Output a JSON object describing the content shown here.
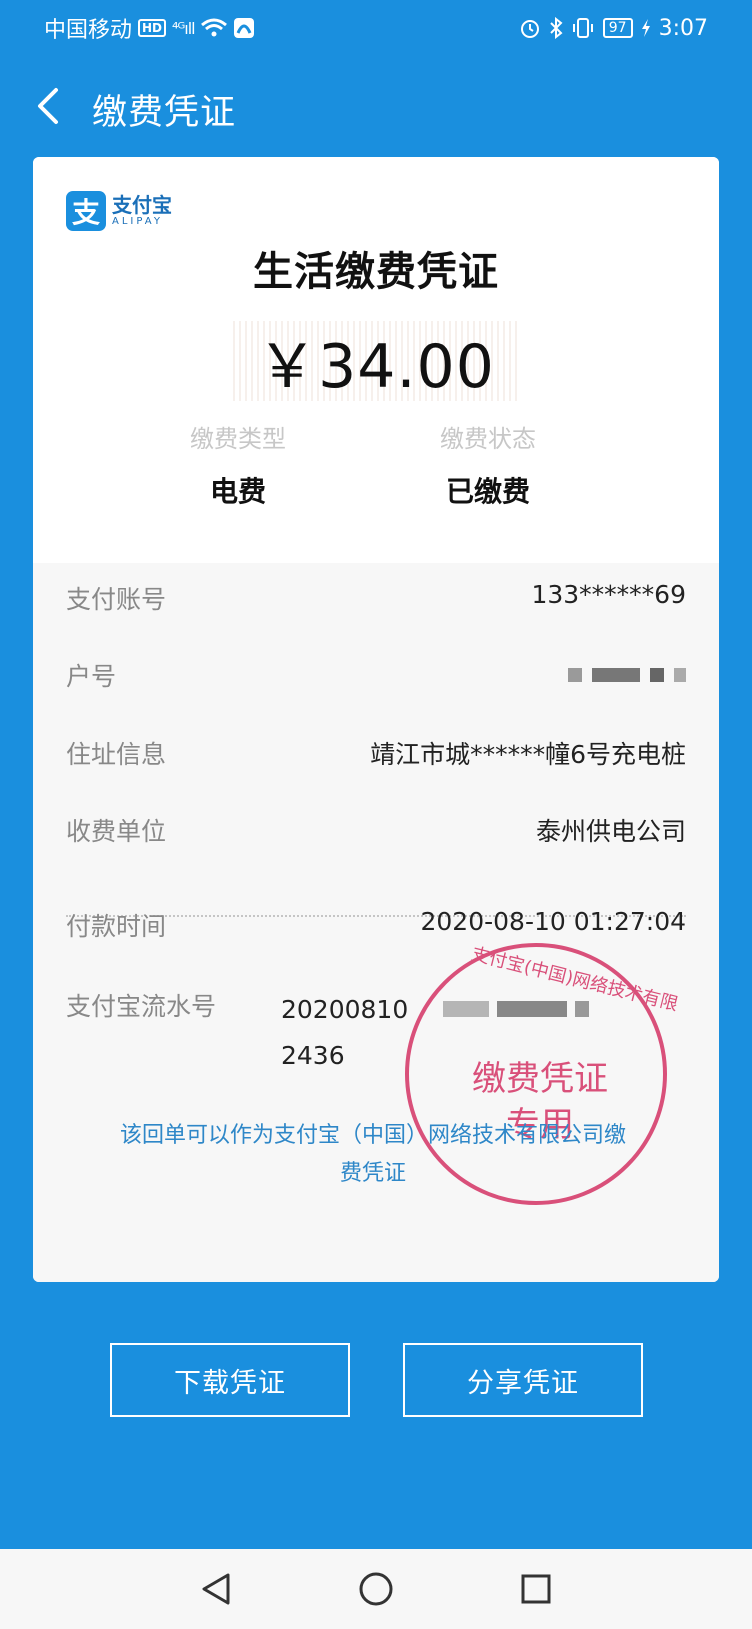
{
  "status_bar": {
    "carrier": "中国移动",
    "hd": "HD",
    "signal": "⁴ᴳıll",
    "battery": "97",
    "time": "3:07"
  },
  "header": {
    "title": "缴费凭证"
  },
  "receipt": {
    "logo_cn": "支付宝",
    "logo_en": "ALIPAY",
    "logo_mark": "支",
    "title": "生活缴费凭证",
    "amount": "￥34.00",
    "type_label": "缴费类型",
    "type_value": "电费",
    "status_label": "缴费状态",
    "status_value": "已缴费",
    "rows": [
      {
        "label": "支付账号",
        "value": "133******69"
      },
      {
        "label": "户号",
        "value": ""
      },
      {
        "label": "住址信息",
        "value": "靖江市城******幢6号充电桩"
      },
      {
        "label": "收费单位",
        "value": "泰州供电公司"
      },
      {
        "label": "付款时间",
        "value": "2020-08-10 01:27:04"
      }
    ],
    "serial_label": "支付宝流水号",
    "serial_line1": "20200810",
    "serial_line2": "2436",
    "footnote": "该回单可以作为支付宝（中国）网络技术有限公司缴费凭证",
    "stamp_ring": "支付宝(中国)网络技术有限",
    "stamp_line1": "缴费凭证",
    "stamp_line2": "专用"
  },
  "actions": {
    "download": "下载凭证",
    "share": "分享凭证"
  },
  "colors": {
    "primary": "#1a8fde",
    "stamp": "#d9507a",
    "footnote": "#2e87c8"
  }
}
